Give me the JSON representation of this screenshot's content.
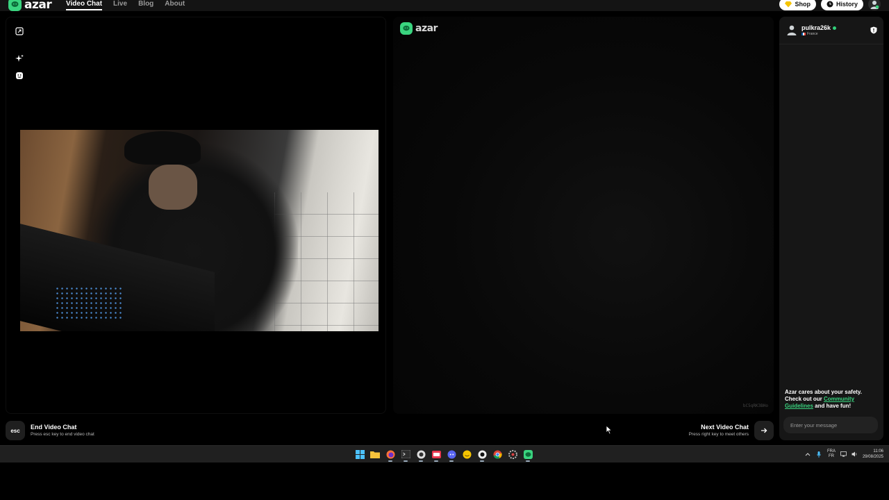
{
  "brand": {
    "name": "azar",
    "accent": "#3ad47f"
  },
  "nav": {
    "items": [
      {
        "label": "Video Chat",
        "active": true
      },
      {
        "label": "Live",
        "active": false
      },
      {
        "label": "Blog",
        "active": false
      },
      {
        "label": "About",
        "active": false
      }
    ]
  },
  "top_actions": {
    "shop_label": "Shop",
    "history_label": "History"
  },
  "partner_video": {
    "logo": "azar",
    "session_id": "bC5qRK3BHo"
  },
  "controls": {
    "esc_key": "esc",
    "end_title": "End Video Chat",
    "end_hint": "Press esc key to end video chat",
    "next_title": "Next Video Chat",
    "next_hint": "Press right key to meet others"
  },
  "chat": {
    "username": "pulkra26k",
    "country": "France",
    "safety_line1": "Azar cares about your safety.",
    "safety_line2": "Check out our ",
    "safety_link": "Community Guidelines",
    "safety_line3": " and have fun!",
    "input_placeholder": "Enter your message"
  },
  "taskbar": {
    "lang_top": "FRA",
    "lang_bottom": "FR",
    "time": "11:06",
    "date": "29/08/2025"
  }
}
